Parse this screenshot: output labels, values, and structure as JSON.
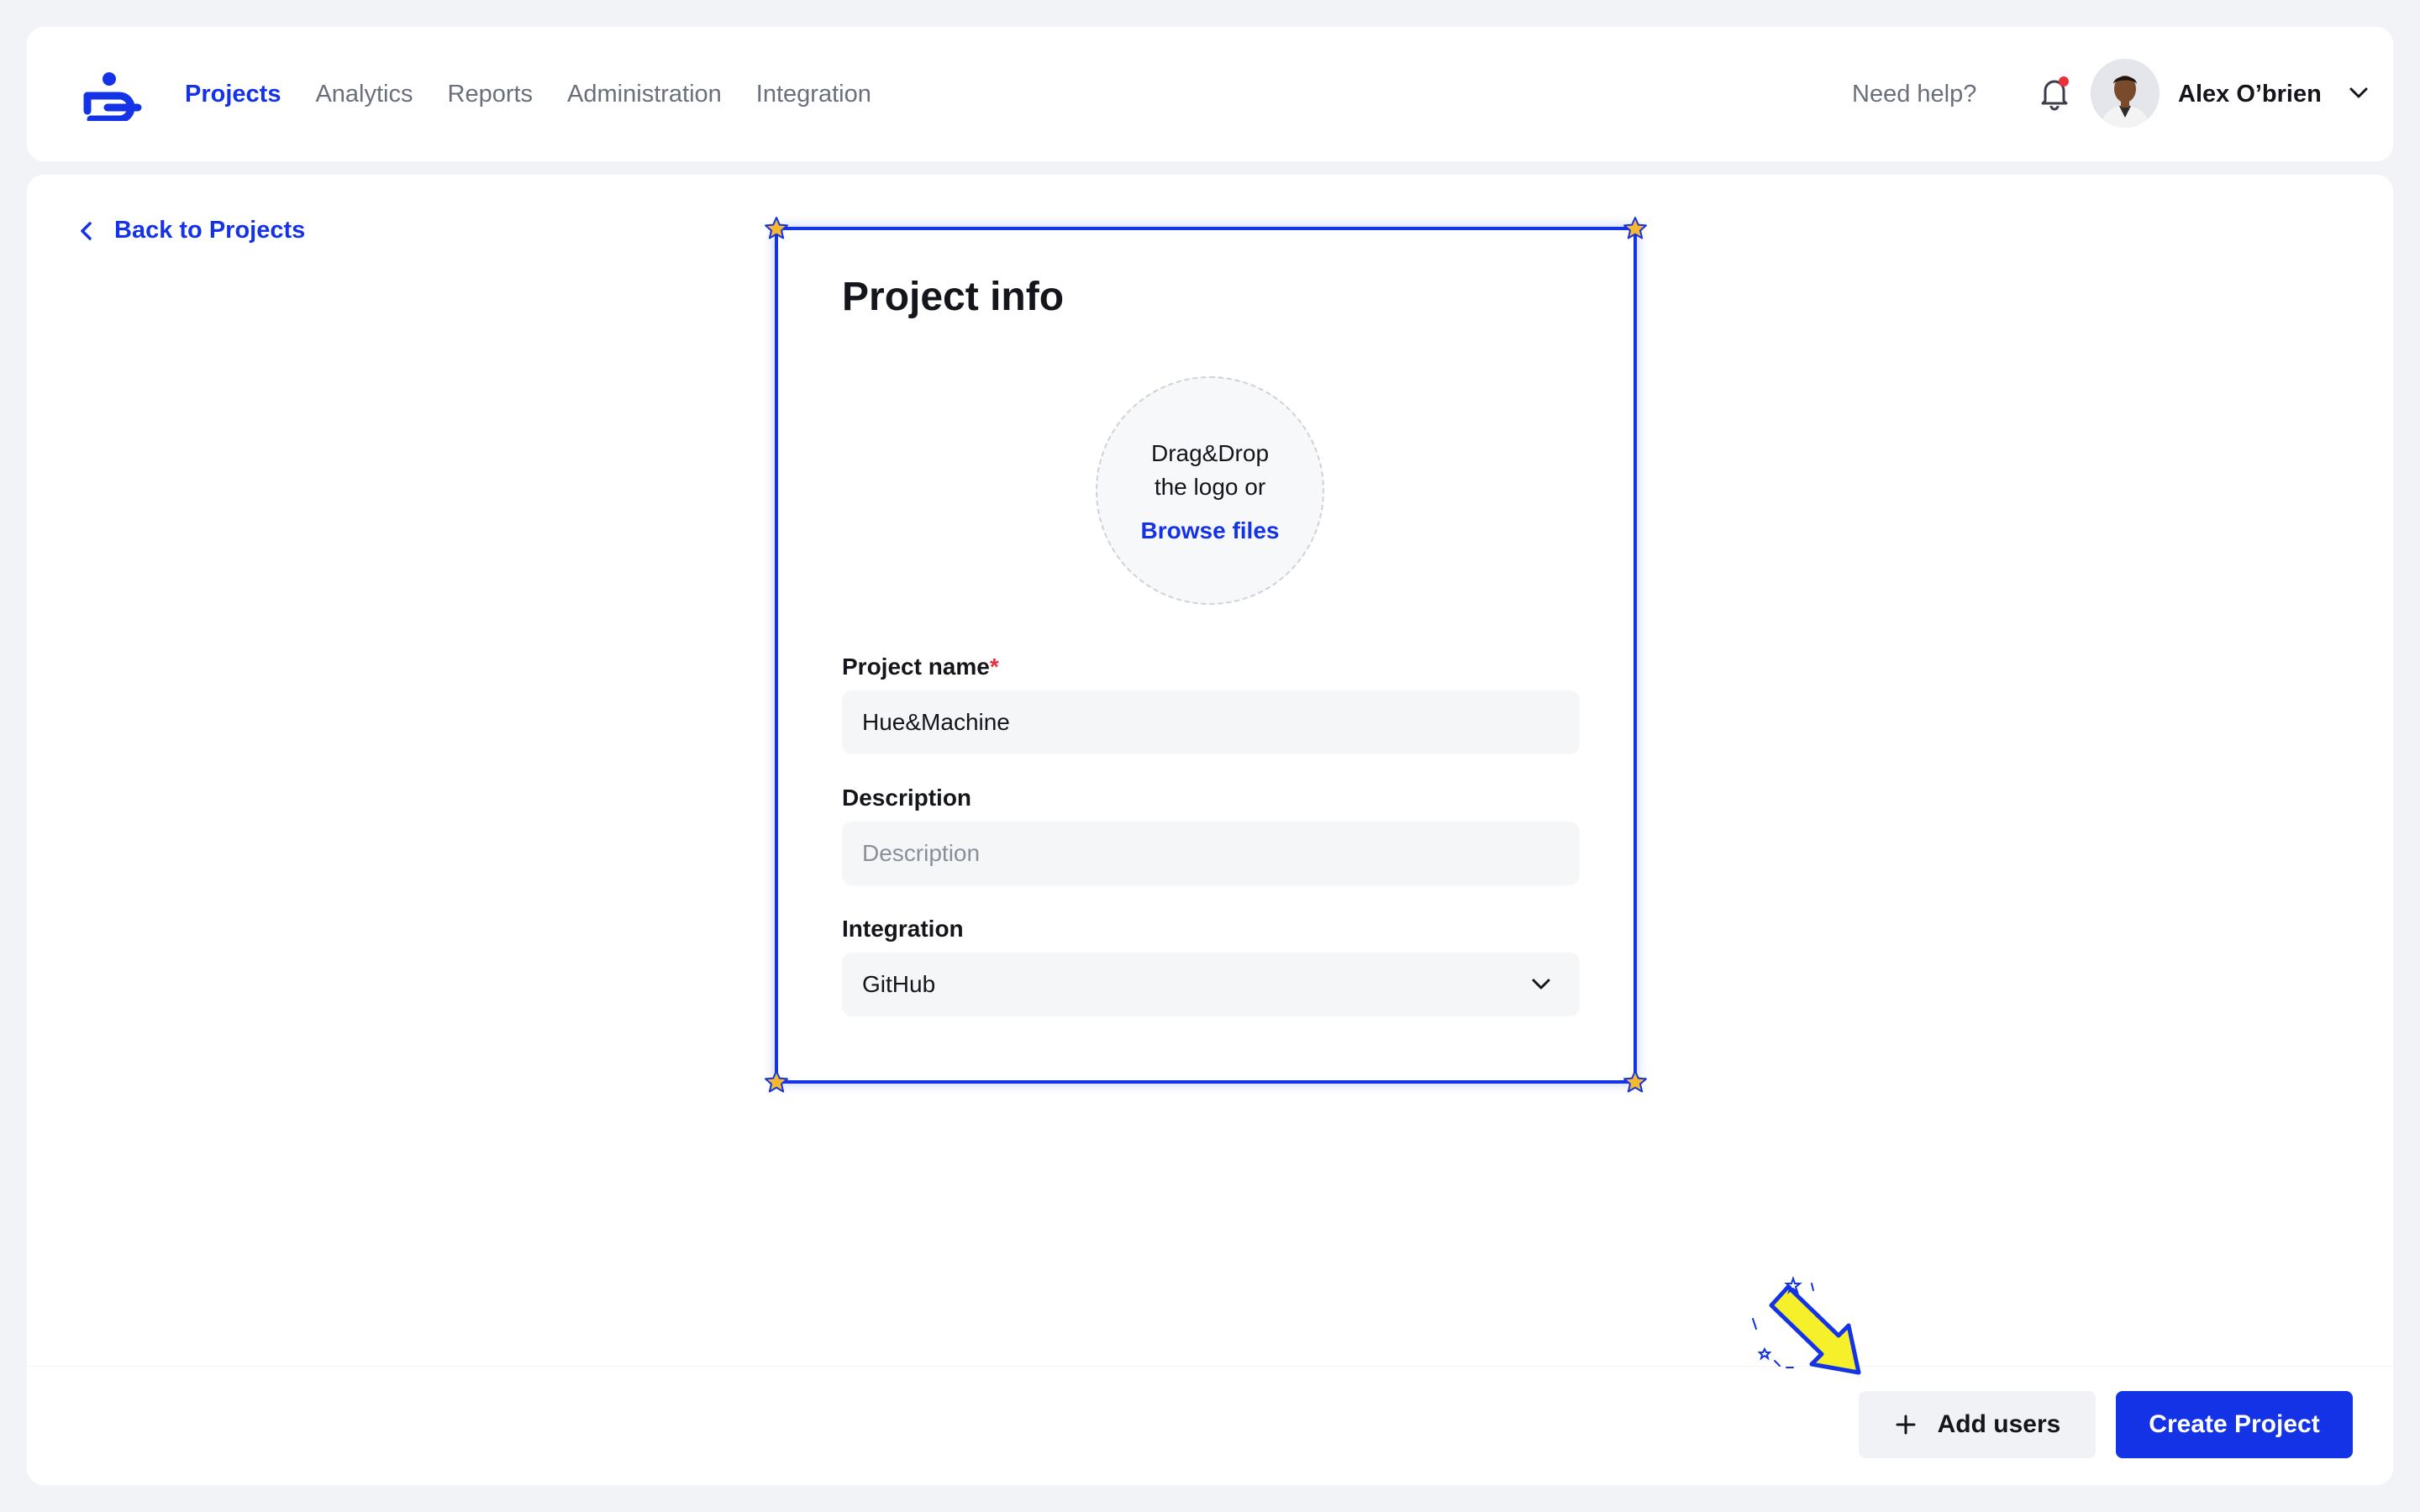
{
  "header": {
    "nav": [
      {
        "label": "Projects",
        "active": true
      },
      {
        "label": "Analytics",
        "active": false
      },
      {
        "label": "Reports",
        "active": false
      },
      {
        "label": "Administration",
        "active": false
      },
      {
        "label": "Integration",
        "active": false
      }
    ],
    "help_label": "Need help?",
    "notification_dot": true,
    "user_name": "Alex O’brien"
  },
  "back_link": "Back to Projects",
  "card": {
    "title": "Project info",
    "dropzone": {
      "text": "Drag&Drop the logo or",
      "browse_label": "Browse files"
    },
    "fields": {
      "project_name": {
        "label": "Project name",
        "required_mark": "*",
        "value": "Hue&Machine"
      },
      "description": {
        "label": "Description",
        "value": "",
        "placeholder": "Description"
      },
      "integration": {
        "label": "Integration",
        "value": "GitHub"
      }
    }
  },
  "footer": {
    "add_users_label": "Add users",
    "create_label": "Create Project"
  },
  "colors": {
    "accent": "#1432e6",
    "required": "#e8303a",
    "highlight_arrow": "#f6f02a",
    "star": "#f5b82e"
  }
}
